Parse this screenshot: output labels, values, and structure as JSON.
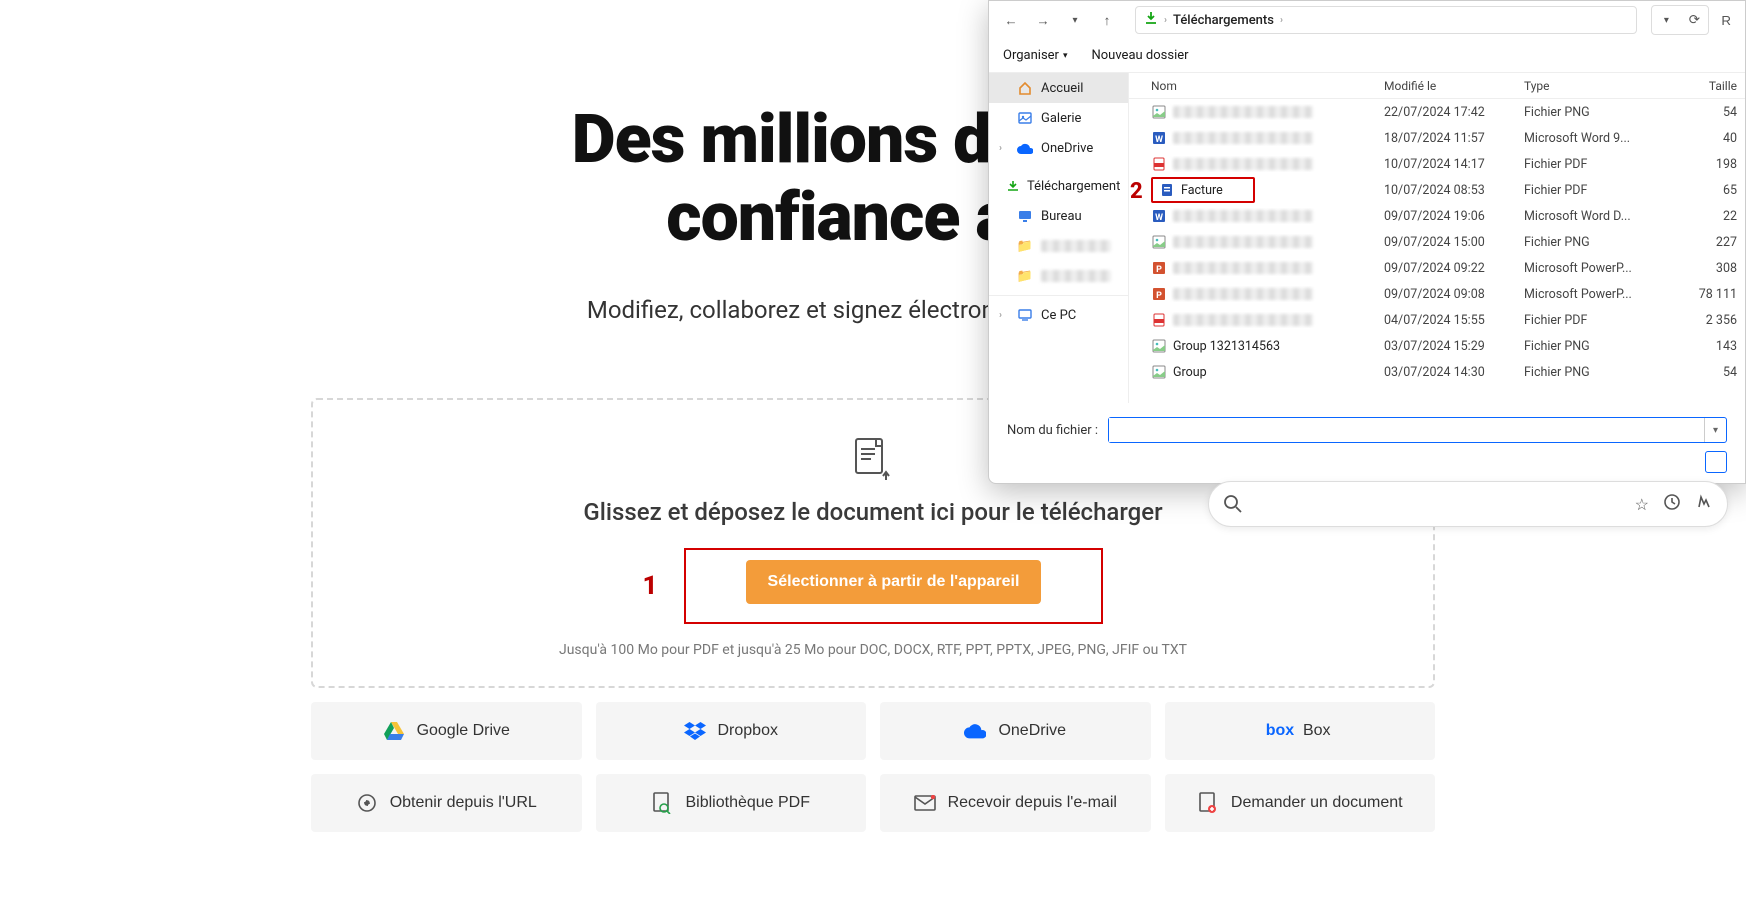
{
  "landing": {
    "headline_line1": "Des millions de pers",
    "headline_line2": "confiance ave",
    "subtitle": "Modifiez, collaborez et signez électroniquement des d",
    "drop_text": "Glissez et déposez le document ici pour le télécharger",
    "select_btn": "Sélectionner à partir de l'appareil",
    "limits": "Jusqu'à 100 Mo pour PDF et jusqu'à 25 Mo pour DOC, DOCX, RTF, PPT, PPTX, JPEG, PNG, JFIF ou TXT",
    "annot1": "1",
    "sources": {
      "gdrive": "Google Drive",
      "dropbox": "Dropbox",
      "onedrive": "OneDrive",
      "box": "Box",
      "url": "Obtenir depuis l'URL",
      "library": "Bibliothèque PDF",
      "email": "Recevoir depuis l'e-mail",
      "request": "Demander un document"
    }
  },
  "dialog": {
    "breadcrumb": "Téléchargements",
    "toolbar": {
      "organize": "Organiser",
      "newfolder": "Nouveau dossier",
      "refresh_hint": "R"
    },
    "sidebar": {
      "home": "Accueil",
      "gallery": "Galerie",
      "onedrive": "OneDrive",
      "downloads": "Téléchargement",
      "desktop": "Bureau",
      "thispc": "Ce PC"
    },
    "columns": {
      "name": "Nom",
      "modified": "Modifié le",
      "type": "Type",
      "size": "Taille"
    },
    "annot2": "2",
    "rows": [
      {
        "name": "",
        "blur": true,
        "date": "22/07/2024 17:42",
        "type": "Fichier PNG",
        "size": "54",
        "icon": "png"
      },
      {
        "name": "",
        "blur": true,
        "date": "18/07/2024 11:57",
        "type": "Microsoft Word 9...",
        "size": "40",
        "icon": "word"
      },
      {
        "name": "",
        "blur": true,
        "date": "10/07/2024 14:17",
        "type": "Fichier PDF",
        "size": "198",
        "icon": "pdf"
      },
      {
        "name": "Facture",
        "blur": false,
        "date": "10/07/2024 08:53",
        "type": "Fichier PDF",
        "size": "65",
        "icon": "pdf",
        "highlight": true
      },
      {
        "name": "",
        "blur": true,
        "date": "09/07/2024 19:06",
        "type": "Microsoft Word D...",
        "size": "22",
        "icon": "word"
      },
      {
        "name": "",
        "blur": true,
        "date": "09/07/2024 15:00",
        "type": "Fichier PNG",
        "size": "227",
        "icon": "png"
      },
      {
        "name": "",
        "blur": true,
        "date": "09/07/2024 09:22",
        "type": "Microsoft PowerP...",
        "size": "308",
        "icon": "ppt"
      },
      {
        "name": "",
        "blur": true,
        "date": "09/07/2024 09:08",
        "type": "Microsoft PowerP...",
        "size": "78 111",
        "icon": "ppt"
      },
      {
        "name": "",
        "blur": true,
        "date": "04/07/2024 15:55",
        "type": "Fichier PDF",
        "size": "2 356",
        "icon": "pdf"
      },
      {
        "name": "Group 1321314563",
        "blur": false,
        "date": "03/07/2024 15:29",
        "type": "Fichier PNG",
        "size": "143",
        "icon": "png"
      },
      {
        "name": "Group",
        "blur": false,
        "date": "03/07/2024 14:30",
        "type": "Fichier PNG",
        "size": "54",
        "icon": "png"
      }
    ],
    "filename_label": "Nom du fichier :",
    "filename_value": ""
  }
}
